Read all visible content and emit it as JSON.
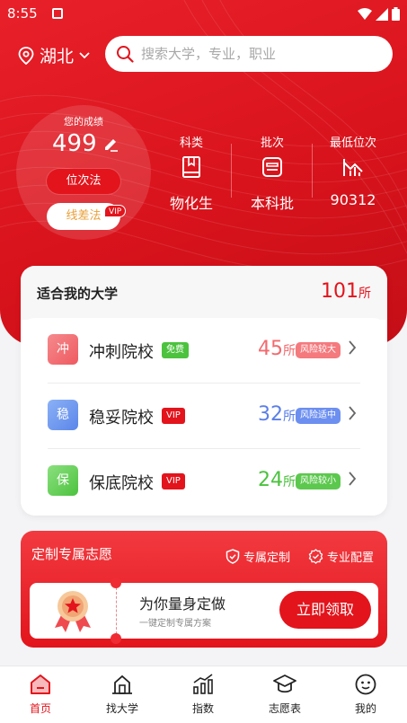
{
  "status_bar": {
    "time": "8:55"
  },
  "location": {
    "city": "湖北"
  },
  "search": {
    "placeholder": "搜索大学，专业，职业"
  },
  "score": {
    "label": "您的成绩",
    "value": "499",
    "btn_rank": "位次法",
    "btn_diff": "线差法",
    "vip": "VIP"
  },
  "metrics": [
    {
      "label": "科类",
      "value": "物化生",
      "icon": "book-icon"
    },
    {
      "label": "批次",
      "value": "本科批",
      "icon": "batch-icon"
    },
    {
      "label": "最低位次",
      "value": "90312",
      "icon": "rank-chart-icon"
    }
  ],
  "universities": {
    "title": "适合我的大学",
    "total": "101",
    "unit": "所",
    "rows": [
      {
        "badge": "冲",
        "name": "冲刺院校",
        "tag": "免费",
        "count": "45",
        "unit": "所",
        "risk": "风险较大"
      },
      {
        "badge": "稳",
        "name": "稳妥院校",
        "tag": "VIP",
        "count": "32",
        "unit": "所",
        "risk": "风险适中"
      },
      {
        "badge": "保",
        "name": "保底院校",
        "tag": "VIP",
        "count": "24",
        "unit": "所",
        "risk": "风险较小"
      }
    ]
  },
  "custom": {
    "title": "定制专属志愿",
    "feature1": "专属定制",
    "feature2": "专业配置",
    "main": "为你量身定做",
    "sub": "一键定制专属方案",
    "button": "立即领取"
  },
  "tabs": [
    {
      "label": "首页",
      "icon": "home-icon"
    },
    {
      "label": "找大学",
      "icon": "university-icon"
    },
    {
      "label": "指数",
      "icon": "index-chart-icon"
    },
    {
      "label": "志愿表",
      "icon": "graduation-cap-icon"
    },
    {
      "label": "我的",
      "icon": "profile-icon"
    }
  ],
  "colors": {
    "primary": "#e3141c",
    "rush": "#f26a6e",
    "steady": "#5b7fe8",
    "safe": "#4cc23e",
    "line_diff_text": "#e9a03a"
  }
}
